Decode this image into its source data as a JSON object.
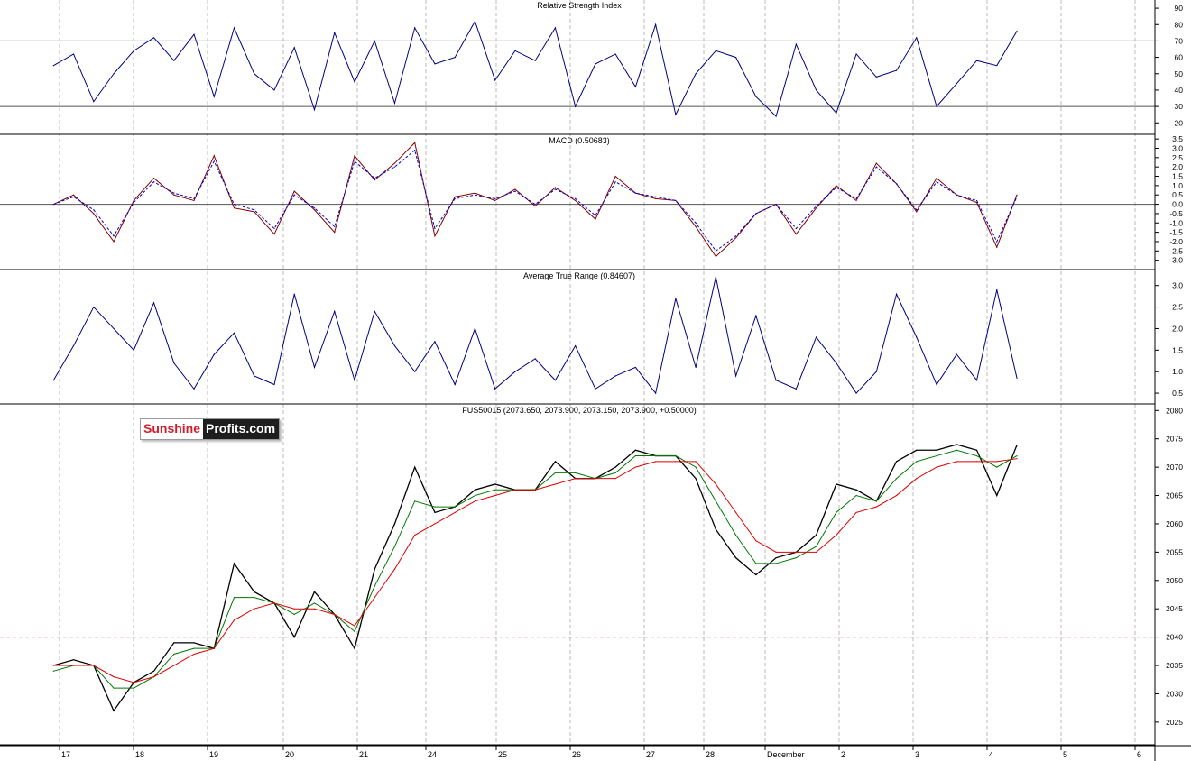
{
  "logo": {
    "part1": "Sunshine",
    "part2": "Profits.com"
  },
  "chart_data": [
    {
      "type": "line",
      "title": "Relative Strength Index",
      "ylim": [
        13,
        95
      ],
      "y_ticks": [
        "20",
        "30",
        "40",
        "50",
        "60",
        "70",
        "80",
        "90"
      ],
      "reference_lines": [
        70,
        30
      ],
      "series": [
        {
          "color": "#000080",
          "x": [
            0,
            0.3,
            0.6,
            0.9,
            1.2,
            1.5,
            1.8,
            2.1,
            2.4,
            2.7,
            3.0,
            3.3,
            3.6,
            3.9,
            4.2,
            4.5,
            4.8,
            5.1,
            5.4,
            5.7,
            6.0,
            6.3,
            6.6,
            6.9,
            7.2,
            7.5,
            7.8,
            8.1,
            8.4,
            8.7,
            9.0,
            9.3,
            9.6,
            9.9,
            10.2,
            10.5,
            10.8,
            11.1,
            11.4,
            11.7,
            12.0,
            12.3,
            12.6,
            12.9,
            13.2,
            13.5,
            13.8,
            14.1,
            14.4
          ],
          "y": [
            55,
            62,
            33,
            50,
            64,
            72,
            58,
            74,
            36,
            78,
            50,
            40,
            66,
            28,
            75,
            45,
            70,
            32,
            78,
            56,
            60,
            82,
            46,
            64,
            58,
            78,
            30,
            56,
            62,
            42,
            80,
            25,
            50,
            64,
            60,
            36,
            24,
            68,
            40,
            26,
            62,
            48,
            52,
            72,
            30,
            44,
            58,
            55,
            76
          ]
        }
      ]
    },
    {
      "type": "line",
      "title": "MACD (0.50683)",
      "ylim": [
        -3.5,
        3.7
      ],
      "y_ticks": [
        "3.5",
        "3.0",
        "2.5",
        "2.0",
        "1.5",
        "1.0",
        "0.5",
        "0.0",
        "-0.5",
        "-1.0",
        "-1.5",
        "-2.0",
        "-2.5",
        "-3.0"
      ],
      "reference_lines": [
        0
      ],
      "series": [
        {
          "name": "",
          "color": "#800000",
          "dashed": false,
          "x": [
            0,
            0.3,
            0.6,
            0.9,
            1.2,
            1.5,
            1.8,
            2.1,
            2.4,
            2.7,
            3.0,
            3.3,
            3.6,
            3.9,
            4.2,
            4.5,
            4.8,
            5.1,
            5.4,
            5.7,
            6.0,
            6.3,
            6.6,
            6.9,
            7.2,
            7.5,
            7.8,
            8.1,
            8.4,
            8.7,
            9.0,
            9.3,
            9.6,
            9.9,
            10.2,
            10.5,
            10.8,
            11.1,
            11.4,
            11.7,
            12.0,
            12.3,
            12.6,
            12.9,
            13.2,
            13.5,
            13.8,
            14.1,
            14.4
          ],
          "y": [
            0,
            0.5,
            -0.5,
            -2.0,
            0.2,
            1.4,
            0.5,
            0.2,
            2.6,
            -0.2,
            -0.4,
            -1.6,
            0.7,
            -0.3,
            -1.5,
            2.6,
            1.3,
            2.2,
            3.3,
            -1.7,
            0.4,
            0.6,
            0.2,
            0.8,
            -0.1,
            0.9,
            0.2,
            -0.8,
            1.5,
            0.6,
            0.3,
            0.2,
            -1.2,
            -2.8,
            -1.8,
            -0.5,
            0.0,
            -1.6,
            -0.2,
            1.0,
            0.2,
            2.2,
            1.1,
            -0.4,
            1.4,
            0.5,
            0.1,
            -2.3,
            0.5
          ]
        },
        {
          "name": "",
          "color": "#0000cc",
          "dashed": true,
          "x": [
            0,
            0.3,
            0.6,
            0.9,
            1.2,
            1.5,
            1.8,
            2.1,
            2.4,
            2.7,
            3.0,
            3.3,
            3.6,
            3.9,
            4.2,
            4.5,
            4.8,
            5.1,
            5.4,
            5.7,
            6.0,
            6.3,
            6.6,
            6.9,
            7.2,
            7.5,
            7.8,
            8.1,
            8.4,
            8.7,
            9.0,
            9.3,
            9.6,
            9.9,
            10.2,
            10.5,
            10.8,
            11.1,
            11.4,
            11.7,
            12.0,
            12.3,
            12.6,
            12.9,
            13.2,
            13.5,
            13.8,
            14.1,
            14.4
          ],
          "y": [
            0,
            0.4,
            -0.3,
            -1.7,
            0.1,
            1.2,
            0.6,
            0.3,
            2.3,
            0.0,
            -0.3,
            -1.3,
            0.5,
            -0.2,
            -1.2,
            2.3,
            1.4,
            2.0,
            2.9,
            -1.3,
            0.3,
            0.5,
            0.3,
            0.7,
            0.0,
            0.8,
            0.3,
            -0.6,
            1.2,
            0.6,
            0.4,
            0.2,
            -1.0,
            -2.5,
            -1.7,
            -0.5,
            0.0,
            -1.3,
            -0.1,
            0.9,
            0.3,
            2.0,
            1.1,
            -0.3,
            1.2,
            0.5,
            0.2,
            -2.0,
            0.4
          ]
        }
      ]
    },
    {
      "type": "line",
      "title": "Average True Range (0.84607)",
      "ylim": [
        0.25,
        3.35
      ],
      "y_ticks": [
        "3.0",
        "2.5",
        "2.0",
        "1.5",
        "1.0",
        "0.5"
      ],
      "series": [
        {
          "color": "#000080",
          "x": [
            0,
            0.3,
            0.6,
            0.9,
            1.2,
            1.5,
            1.8,
            2.1,
            2.4,
            2.7,
            3.0,
            3.3,
            3.6,
            3.9,
            4.2,
            4.5,
            4.8,
            5.1,
            5.4,
            5.7,
            6.0,
            6.3,
            6.6,
            6.9,
            7.2,
            7.5,
            7.8,
            8.1,
            8.4,
            8.7,
            9.0,
            9.3,
            9.6,
            9.9,
            10.2,
            10.5,
            10.8,
            11.1,
            11.4,
            11.7,
            12.0,
            12.3,
            12.6,
            12.9,
            13.2,
            13.5,
            13.8,
            14.1,
            14.4
          ],
          "y": [
            0.8,
            1.6,
            2.5,
            2.0,
            1.5,
            2.6,
            1.2,
            0.6,
            1.4,
            1.9,
            0.9,
            0.7,
            2.8,
            1.1,
            2.4,
            0.8,
            2.4,
            1.6,
            1.0,
            1.7,
            0.7,
            2.0,
            0.6,
            1.0,
            1.3,
            0.8,
            1.6,
            0.6,
            0.9,
            1.1,
            0.5,
            2.7,
            1.1,
            3.2,
            0.9,
            2.3,
            0.8,
            0.6,
            1.8,
            1.2,
            0.5,
            1.0,
            2.8,
            1.8,
            0.7,
            1.4,
            0.8,
            2.9,
            0.85
          ]
        }
      ]
    },
    {
      "type": "line",
      "title": "FUS50015 (2073.650, 2073.900, 2073.150, 2073.900, +0.50000)",
      "ylim": [
        2021,
        2081
      ],
      "y_ticks": [
        "2080",
        "2075",
        "2070",
        "2065",
        "2060",
        "2055",
        "2050",
        "2045",
        "2040",
        "2035",
        "2030",
        "2025"
      ],
      "reference_lines": [
        2040
      ],
      "x_ticks": [
        "17",
        "18",
        "19",
        "20",
        "21",
        "24",
        "25",
        "26",
        "27",
        "28",
        "December",
        "2",
        "3",
        "4",
        "5",
        "6"
      ],
      "series": [
        {
          "name": "",
          "color": "#000000",
          "x": [
            0,
            0.3,
            0.6,
            0.9,
            1.2,
            1.5,
            1.8,
            2.1,
            2.4,
            2.7,
            3.0,
            3.3,
            3.6,
            3.9,
            4.2,
            4.5,
            4.8,
            5.1,
            5.4,
            5.7,
            6.0,
            6.3,
            6.6,
            6.9,
            7.2,
            7.5,
            7.8,
            8.1,
            8.4,
            8.7,
            9.0,
            9.3,
            9.6,
            9.9,
            10.2,
            10.5,
            10.8,
            11.1,
            11.4,
            11.7,
            12.0,
            12.3,
            12.6,
            12.9,
            13.2,
            13.5,
            13.8,
            14.1,
            14.4
          ],
          "y": [
            2035,
            2036,
            2035,
            2027,
            2032,
            2034,
            2039,
            2039,
            2038,
            2053,
            2048,
            2046,
            2040,
            2048,
            2044,
            2038,
            2052,
            2060,
            2070,
            2062,
            2063,
            2066,
            2067,
            2066,
            2066,
            2071,
            2068,
            2068,
            2070,
            2073,
            2072,
            2072,
            2068,
            2059,
            2054,
            2051,
            2054,
            2055,
            2058,
            2067,
            2066,
            2064,
            2071,
            2073,
            2073,
            2074,
            2073,
            2065,
            2073.9
          ]
        },
        {
          "name": "",
          "color": "#007700",
          "x": [
            0,
            0.3,
            0.6,
            0.9,
            1.2,
            1.5,
            1.8,
            2.1,
            2.4,
            2.7,
            3.0,
            3.3,
            3.6,
            3.9,
            4.2,
            4.5,
            4.8,
            5.1,
            5.4,
            5.7,
            6.0,
            6.3,
            6.6,
            6.9,
            7.2,
            7.5,
            7.8,
            8.1,
            8.4,
            8.7,
            9.0,
            9.3,
            9.6,
            9.9,
            10.2,
            10.5,
            10.8,
            11.1,
            11.4,
            11.7,
            12.0,
            12.3,
            12.6,
            12.9,
            13.2,
            13.5,
            13.8,
            14.1,
            14.4
          ],
          "y": [
            2034,
            2035,
            2035,
            2031,
            2031,
            2033,
            2037,
            2038,
            2038,
            2047,
            2047,
            2046,
            2044,
            2046,
            2044,
            2041,
            2049,
            2056,
            2064,
            2063,
            2063,
            2065,
            2066,
            2066,
            2066,
            2069,
            2069,
            2068,
            2069,
            2072,
            2072,
            2072,
            2070,
            2064,
            2058,
            2053,
            2053,
            2054,
            2056,
            2062,
            2065,
            2064,
            2068,
            2071,
            2072,
            2073,
            2072,
            2070,
            2072
          ]
        },
        {
          "name": "",
          "color": "#dd0000",
          "x": [
            0,
            0.3,
            0.6,
            0.9,
            1.2,
            1.5,
            1.8,
            2.1,
            2.4,
            2.7,
            3.0,
            3.3,
            3.6,
            3.9,
            4.2,
            4.5,
            4.8,
            5.1,
            5.4,
            5.7,
            6.0,
            6.3,
            6.6,
            6.9,
            7.2,
            7.5,
            7.8,
            8.1,
            8.4,
            8.7,
            9.0,
            9.3,
            9.6,
            9.9,
            10.2,
            10.5,
            10.8,
            11.1,
            11.4,
            11.7,
            12.0,
            12.3,
            12.6,
            12.9,
            13.2,
            13.5,
            13.8,
            14.1,
            14.4
          ],
          "y": [
            2035,
            2035,
            2035,
            2033,
            2032,
            2033,
            2035,
            2037,
            2038,
            2043,
            2045,
            2046,
            2045,
            2045,
            2044,
            2042,
            2047,
            2052,
            2058,
            2060,
            2062,
            2064,
            2065,
            2066,
            2066,
            2067,
            2068,
            2068,
            2068,
            2070,
            2071,
            2071,
            2071,
            2067,
            2062,
            2057,
            2055,
            2055,
            2055,
            2058,
            2062,
            2063,
            2065,
            2068,
            2070,
            2071,
            2071,
            2071,
            2071.5
          ]
        }
      ]
    }
  ]
}
